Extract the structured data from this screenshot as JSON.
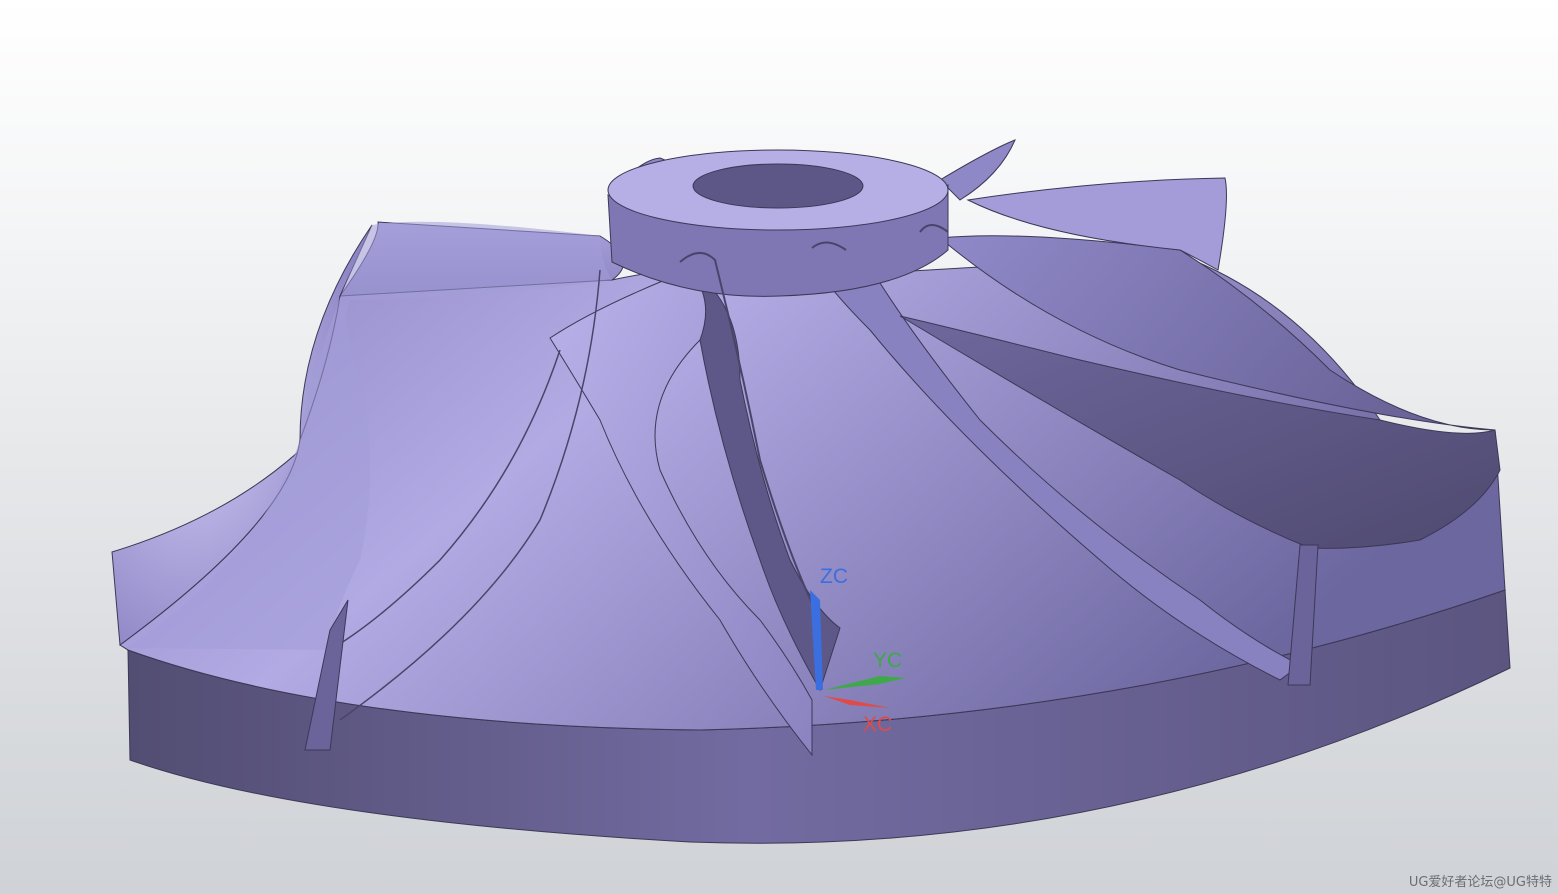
{
  "viewport": {
    "background_top": "#ffffff",
    "background_bottom": "#cfd2d6",
    "model_color": "#9f97d2",
    "model_shadow_color": "#595477"
  },
  "triad": {
    "z_label": "ZC",
    "y_label": "YC",
    "x_label": "XC",
    "z_color": "#3b6fe0",
    "y_color": "#3fa84a",
    "x_color": "#e24a4a"
  },
  "watermark": {
    "text": "UG爱好者论坛@UG特特"
  }
}
